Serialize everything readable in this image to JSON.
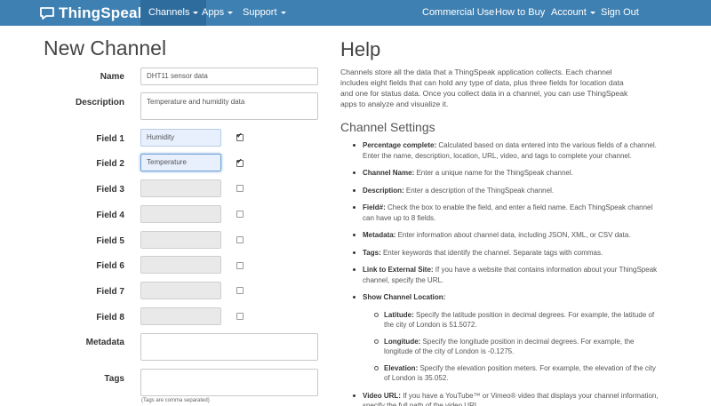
{
  "nav": {
    "brand": "ThingSpeak",
    "brand_tm": "™",
    "channels": "Channels",
    "apps": "Apps",
    "support": "Support",
    "commercial_use": "Commercial Use",
    "how_to_buy": "How to Buy",
    "account": "Account",
    "sign_out": "Sign Out"
  },
  "form": {
    "title": "New Channel",
    "name_label": "Name",
    "name_value": "DHT11 sensor data",
    "description_label": "Description",
    "description_value": "Temperature and humidity data",
    "fields": [
      {
        "label": "Field 1",
        "value": "Humidity",
        "checked": true
      },
      {
        "label": "Field 2",
        "value": "Temperature",
        "checked": true
      },
      {
        "label": "Field 3",
        "value": "",
        "checked": false
      },
      {
        "label": "Field 4",
        "value": "",
        "checked": false
      },
      {
        "label": "Field 5",
        "value": "",
        "checked": false
      },
      {
        "label": "Field 6",
        "value": "",
        "checked": false
      },
      {
        "label": "Field 7",
        "value": "",
        "checked": false
      },
      {
        "label": "Field 8",
        "value": "",
        "checked": false
      }
    ],
    "metadata_label": "Metadata",
    "tags_label": "Tags",
    "tags_hint": "(Tags are comma separated)"
  },
  "help": {
    "title": "Help",
    "intro": "Channels store all the data that a ThingSpeak application collects. Each channel includes eight fields that can hold any type of data, plus three fields for location data and one for status data. Once you collect data in a channel, you can use ThingSpeak apps to analyze and visualize it.",
    "settings_title": "Channel Settings",
    "items": [
      {
        "term": "Percentage complete:",
        "text": " Calculated based on data entered into the various fields of a channel. Enter the name, description, location, URL, video, and tags to complete your channel."
      },
      {
        "term": "Channel Name:",
        "text": " Enter a unique name for the ThingSpeak channel."
      },
      {
        "term": "Description:",
        "text": " Enter a description of the ThingSpeak channel."
      },
      {
        "term": "Field#:",
        "text": " Check the box to enable the field, and enter a field name. Each ThingSpeak channel can have up to 8 fields."
      },
      {
        "term": "Metadata:",
        "text": " Enter information about channel data, including JSON, XML, or CSV data."
      },
      {
        "term": "Tags:",
        "text": " Enter keywords that identify the channel. Separate tags with commas."
      },
      {
        "term": "Link to External Site:",
        "text": " If you have a website that contains information about your ThingSpeak channel, specify the URL."
      },
      {
        "term": "Show Channel Location:",
        "text": ""
      }
    ],
    "location_items": [
      {
        "term": "Latitude:",
        "text": " Specify the latitude position in decimal degrees. For example, the latitude of the city of London is 51.5072."
      },
      {
        "term": "Longitude:",
        "text": " Specify the longitude position in decimal degrees. For example, the longitude of the city of London is -0.1275."
      },
      {
        "term": "Elevation:",
        "text": " Specify the elevation position meters. For example, the elevation of the city of London is 35.052."
      }
    ],
    "video": {
      "term": "Video URL:",
      "text": " If you have a YouTube™ or Vimeo® video that displays your channel information, specify the full path of the video URL."
    }
  }
}
